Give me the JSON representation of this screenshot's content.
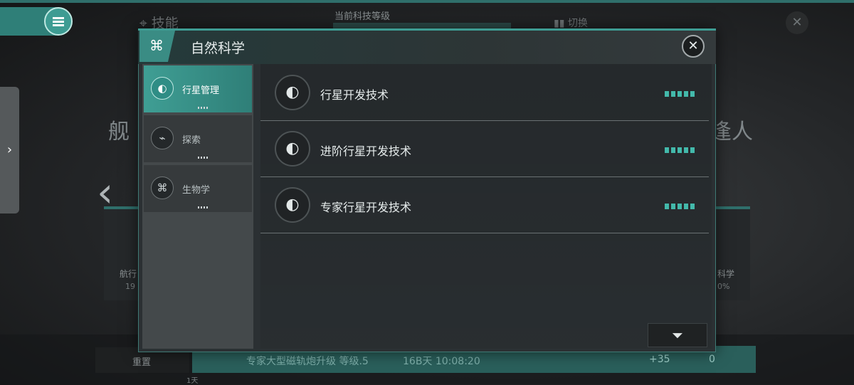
{
  "background": {
    "skill_title": "技能",
    "tech_level_label": "当前科技等级",
    "switch_label": "切换",
    "left_panel_text": "舰",
    "right_panel_text": "逢人",
    "left_card_title": "航行",
    "left_card_value": "19",
    "right_card_title": "科学",
    "right_card_value": "0%",
    "reset_label": "重置",
    "reset_sub": "1天",
    "queue_text": "专家大型磁轨炮升级 等级.5",
    "queue_time": "16B天 10:08:20",
    "queue_count": "+35",
    "queue_tools": "0"
  },
  "dialog": {
    "title": "自然科学",
    "icon": "dna-icon",
    "close": "✕"
  },
  "sidebar": {
    "items": [
      {
        "label": "行星管理",
        "icon": "planet-icon",
        "active": true
      },
      {
        "label": "探索",
        "icon": "satellite-dish-icon",
        "active": false
      },
      {
        "label": "生物学",
        "icon": "dna-icon",
        "active": false
      }
    ]
  },
  "techs": [
    {
      "label": "行星开发技术",
      "icon": "planet-icon",
      "level": 5
    },
    {
      "label": "进阶行星开发技术",
      "icon": "planet-icon",
      "level": 5
    },
    {
      "label": "专家行星开发技术",
      "icon": "planet-icon",
      "level": 5
    }
  ],
  "colors": {
    "accent": "#3e9c93",
    "pip": "#43b9ab",
    "panel": "#2b3033"
  }
}
